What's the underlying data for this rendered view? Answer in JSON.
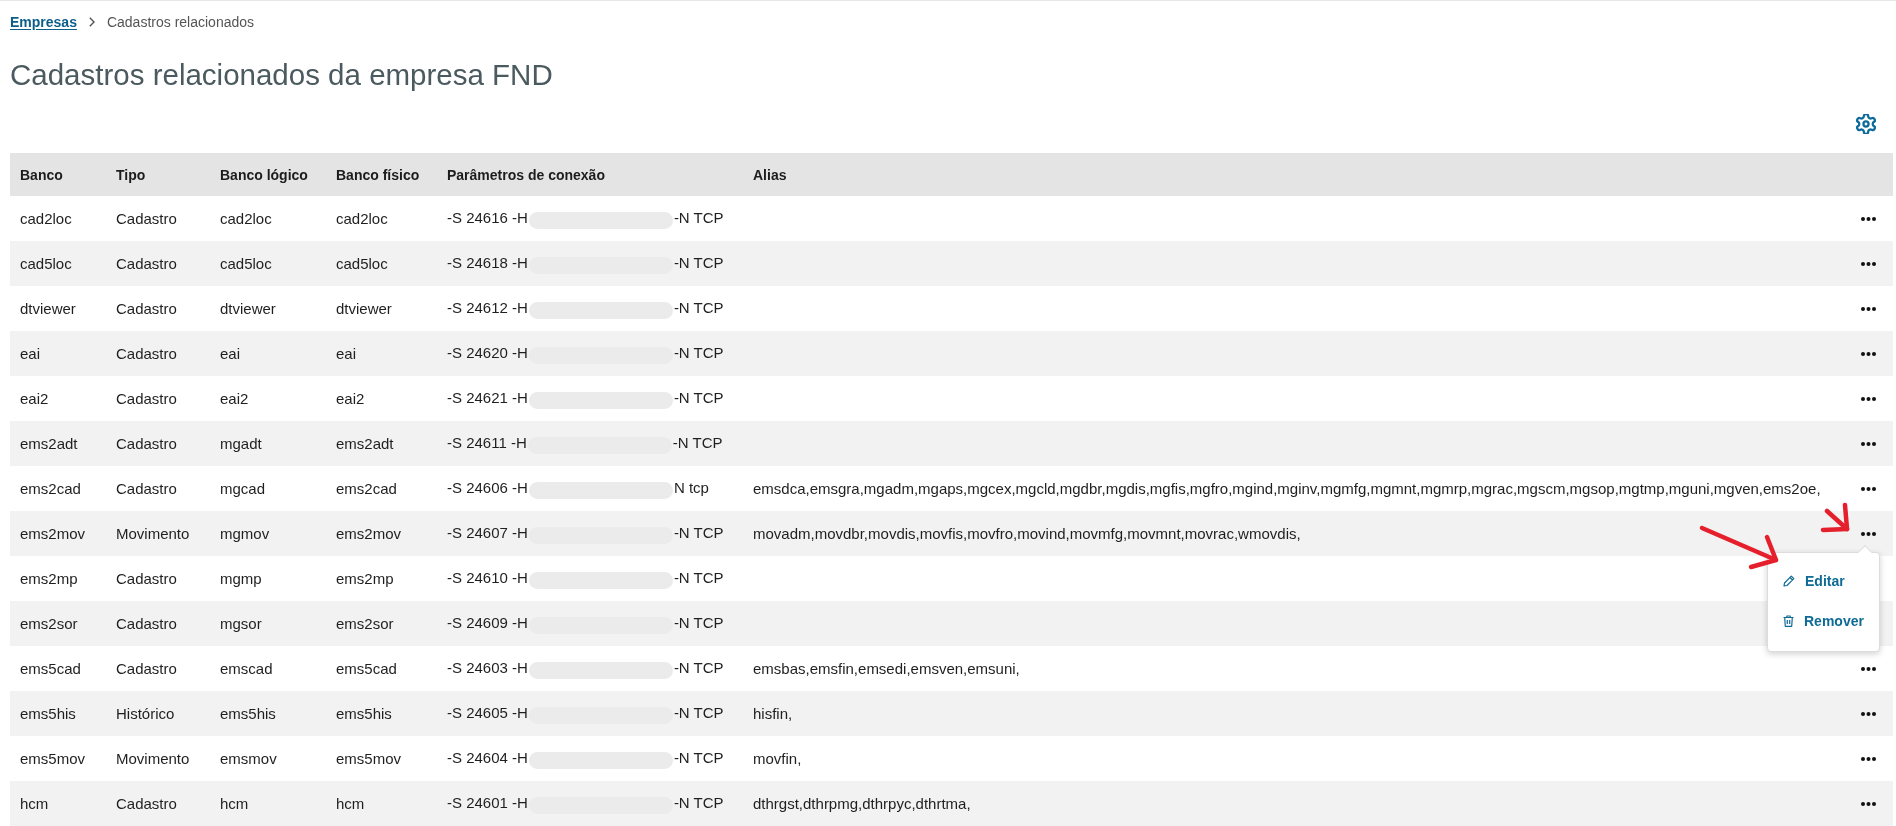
{
  "breadcrumb": [
    {
      "kind": "link",
      "label": "Empresas"
    },
    {
      "kind": "current",
      "label": "Cadastros relacionados"
    }
  ],
  "title": "Cadastros relacionados da empresa FND",
  "table": {
    "columns": [
      "Banco",
      "Tipo",
      "Banco lógico",
      "Banco físico",
      "Parâmetros de conexão",
      "Alias"
    ],
    "rows": [
      {
        "banco": "cad2loc",
        "tipo": "Cadastro",
        "banco_logico": "cad2loc",
        "banco_fisico": "cad2loc",
        "connection": {
          "before_redaction": "-S 24616 -H",
          "after_redaction": "-N TCP"
        },
        "menu_open": false
      },
      {
        "banco": "cad5loc",
        "tipo": "Cadastro",
        "banco_logico": "cad5loc",
        "banco_fisico": "cad5loc",
        "connection": {
          "before_redaction": "-S 24618 -H",
          "after_redaction": "-N TCP"
        },
        "menu_open": false
      },
      {
        "banco": "dtviewer",
        "tipo": "Cadastro",
        "banco_logico": "dtviewer",
        "banco_fisico": "dtviewer",
        "connection": {
          "before_redaction": "-S 24612 -H",
          "after_redaction": "-N TCP"
        },
        "menu_open": false
      },
      {
        "banco": "eai",
        "tipo": "Cadastro",
        "banco_logico": "eai",
        "banco_fisico": "eai",
        "connection": {
          "before_redaction": "-S 24620 -H",
          "after_redaction": "-N TCP"
        },
        "menu_open": false
      },
      {
        "banco": "eai2",
        "tipo": "Cadastro",
        "banco_logico": "eai2",
        "banco_fisico": "eai2",
        "connection": {
          "before_redaction": "-S 24621 -H",
          "after_redaction": "-N TCP"
        },
        "menu_open": false
      },
      {
        "banco": "ems2adt",
        "tipo": "Cadastro",
        "banco_logico": "mgadt",
        "banco_fisico": "ems2adt",
        "connection": {
          "before_redaction": "-S 24611 -H",
          "after_redaction": "-N TCP"
        },
        "menu_open": false
      },
      {
        "banco": "ems2cad",
        "tipo": "Cadastro",
        "banco_logico": "mgcad",
        "banco_fisico": "ems2cad",
        "connection": {
          "before_redaction": "-S 24606 -H",
          "after_redaction": "N tcp"
        },
        "alias": "emsdca,emsgra,mgadm,mgaps,mgcex,mgcld,mgdbr,mgdis,mgfis,mgfro,mgind,mginv,mgmfg,mgmnt,mgmrp,mgrac,mgscm,mgsop,mgtmp,mguni,mgven,ems2oe,",
        "menu_open": false
      },
      {
        "banco": "ems2mov",
        "tipo": "Movimento",
        "banco_logico": "mgmov",
        "banco_fisico": "ems2mov",
        "connection": {
          "before_redaction": "-S 24607 -H",
          "after_redaction": "-N TCP"
        },
        "alias": "movadm,movdbr,movdis,movfis,movfro,movind,movmfg,movmnt,movrac,wmovdis,",
        "menu_open": true
      },
      {
        "banco": "ems2mp",
        "tipo": "Cadastro",
        "banco_logico": "mgmp",
        "banco_fisico": "ems2mp",
        "connection": {
          "before_redaction": "-S 24610 -H",
          "after_redaction": "-N TCP"
        },
        "menu_open": false
      },
      {
        "banco": "ems2sor",
        "tipo": "Cadastro",
        "banco_logico": "mgsor",
        "banco_fisico": "ems2sor",
        "connection": {
          "before_redaction": "-S 24609 -H",
          "after_redaction": "-N TCP"
        },
        "menu_open": false
      },
      {
        "banco": "ems5cad",
        "tipo": "Cadastro",
        "banco_logico": "emscad",
        "banco_fisico": "ems5cad",
        "connection": {
          "before_redaction": "-S 24603 -H",
          "after_redaction": "-N TCP"
        },
        "alias": "emsbas,emsfin,emsedi,emsven,emsuni,",
        "menu_open": false
      },
      {
        "banco": "ems5his",
        "tipo": "Histórico",
        "banco_logico": "ems5his",
        "banco_fisico": "ems5his",
        "connection": {
          "before_redaction": "-S 24605 -H",
          "after_redaction": "-N TCP"
        },
        "alias": "hisfin,",
        "menu_open": false
      },
      {
        "banco": "ems5mov",
        "tipo": "Movimento",
        "banco_logico": "emsmov",
        "banco_fisico": "ems5mov",
        "connection": {
          "before_redaction": "-S 24604 -H",
          "after_redaction": "-N TCP"
        },
        "alias": "movfin,",
        "menu_open": false
      },
      {
        "banco": "hcm",
        "tipo": "Cadastro",
        "banco_logico": "hcm",
        "banco_fisico": "hcm",
        "connection": {
          "before_redaction": "-S 24601 -H",
          "after_redaction": "-N TCP"
        },
        "alias": "dthrgst,dthrpmg,dthrpyc,dthrtma,",
        "menu_open": false
      }
    ]
  },
  "row_menu": {
    "items": [
      {
        "kind": "edit",
        "label": "Editar"
      },
      {
        "kind": "remove",
        "label": "Remover"
      }
    ]
  }
}
